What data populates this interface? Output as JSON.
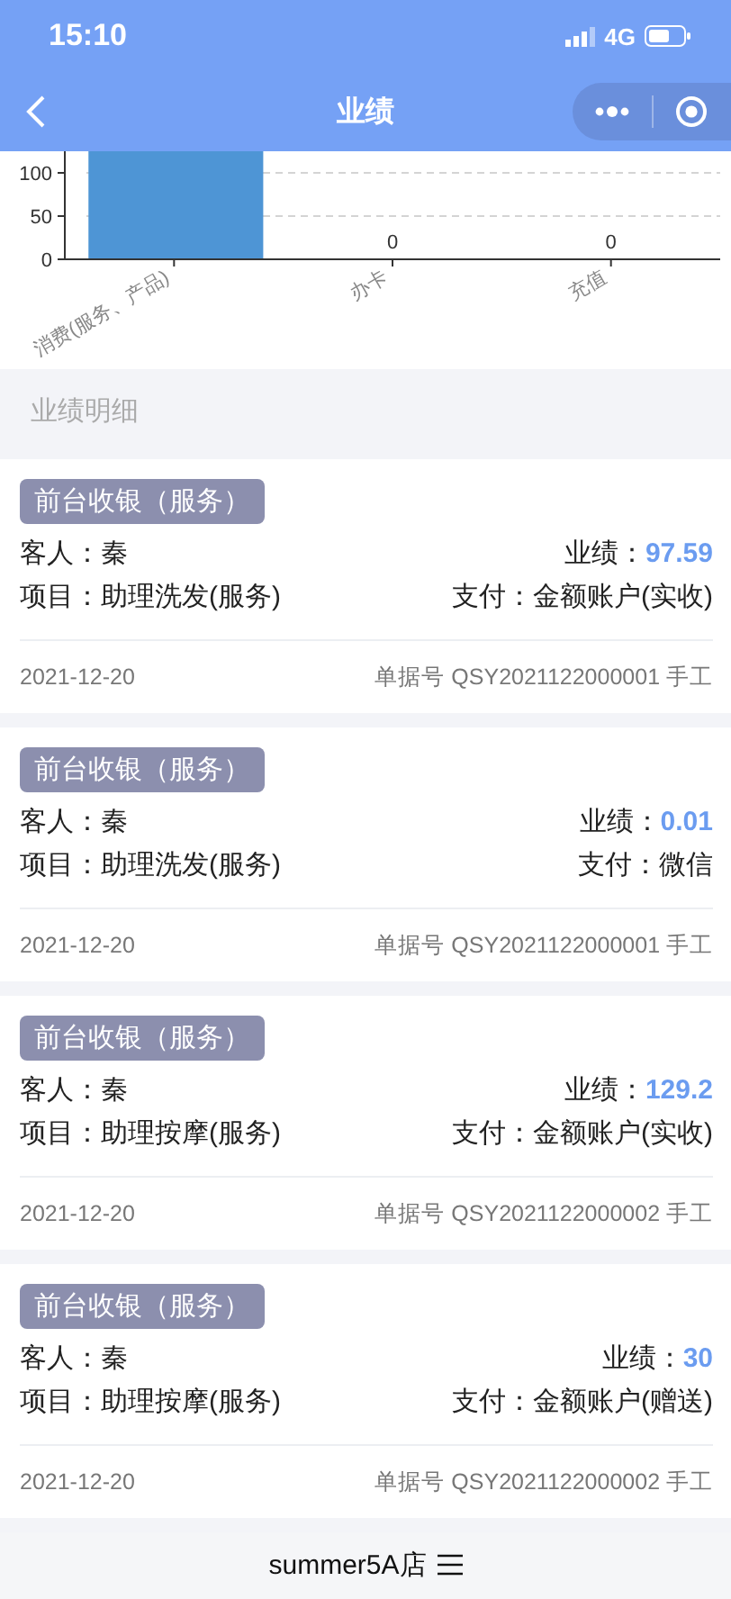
{
  "status_bar": {
    "time": "15:10",
    "network": "4G"
  },
  "nav": {
    "title": "业绩"
  },
  "chart": {
    "chart_data": {
      "type": "bar",
      "categories": [
        "消费(服务、产品)",
        "办卡",
        "充值"
      ],
      "values": [
        125,
        0,
        0
      ],
      "ylim": [
        0,
        125
      ],
      "yticks": [
        0,
        50,
        100
      ],
      "value_labels": [
        null,
        "0",
        "0"
      ]
    }
  },
  "section": {
    "title": "业绩明细"
  },
  "records": [
    {
      "tag": "前台收银（服务）",
      "guest_label": "客人：",
      "guest": "秦",
      "amount_label": "业绩：",
      "amount": "97.59",
      "item_label": "项目：",
      "item": "助理洗发(服务)",
      "pay_label": "支付：",
      "pay": "金额账户(实收)",
      "date": "2021-12-20",
      "doc_label": "单据号",
      "doc_no": "QSY2021122000001",
      "doc_type": "手工"
    },
    {
      "tag": "前台收银（服务）",
      "guest_label": "客人：",
      "guest": "秦",
      "amount_label": "业绩：",
      "amount": "0.01",
      "item_label": "项目：",
      "item": "助理洗发(服务)",
      "pay_label": "支付：",
      "pay": "微信",
      "date": "2021-12-20",
      "doc_label": "单据号",
      "doc_no": "QSY2021122000001",
      "doc_type": "手工"
    },
    {
      "tag": "前台收银（服务）",
      "guest_label": "客人：",
      "guest": "秦",
      "amount_label": "业绩：",
      "amount": "129.2",
      "item_label": "项目：",
      "item": "助理按摩(服务)",
      "pay_label": "支付：",
      "pay": "金额账户(实收)",
      "date": "2021-12-20",
      "doc_label": "单据号",
      "doc_no": "QSY2021122000002",
      "doc_type": "手工"
    },
    {
      "tag": "前台收银（服务）",
      "guest_label": "客人：",
      "guest": "秦",
      "amount_label": "业绩：",
      "amount": "30",
      "item_label": "项目：",
      "item": "助理按摩(服务)",
      "pay_label": "支付：",
      "pay": "金额账户(赠送)",
      "date": "2021-12-20",
      "doc_label": "单据号",
      "doc_no": "QSY2021122000002",
      "doc_type": "手工"
    }
  ],
  "footer": {
    "store": "summer5A店"
  }
}
